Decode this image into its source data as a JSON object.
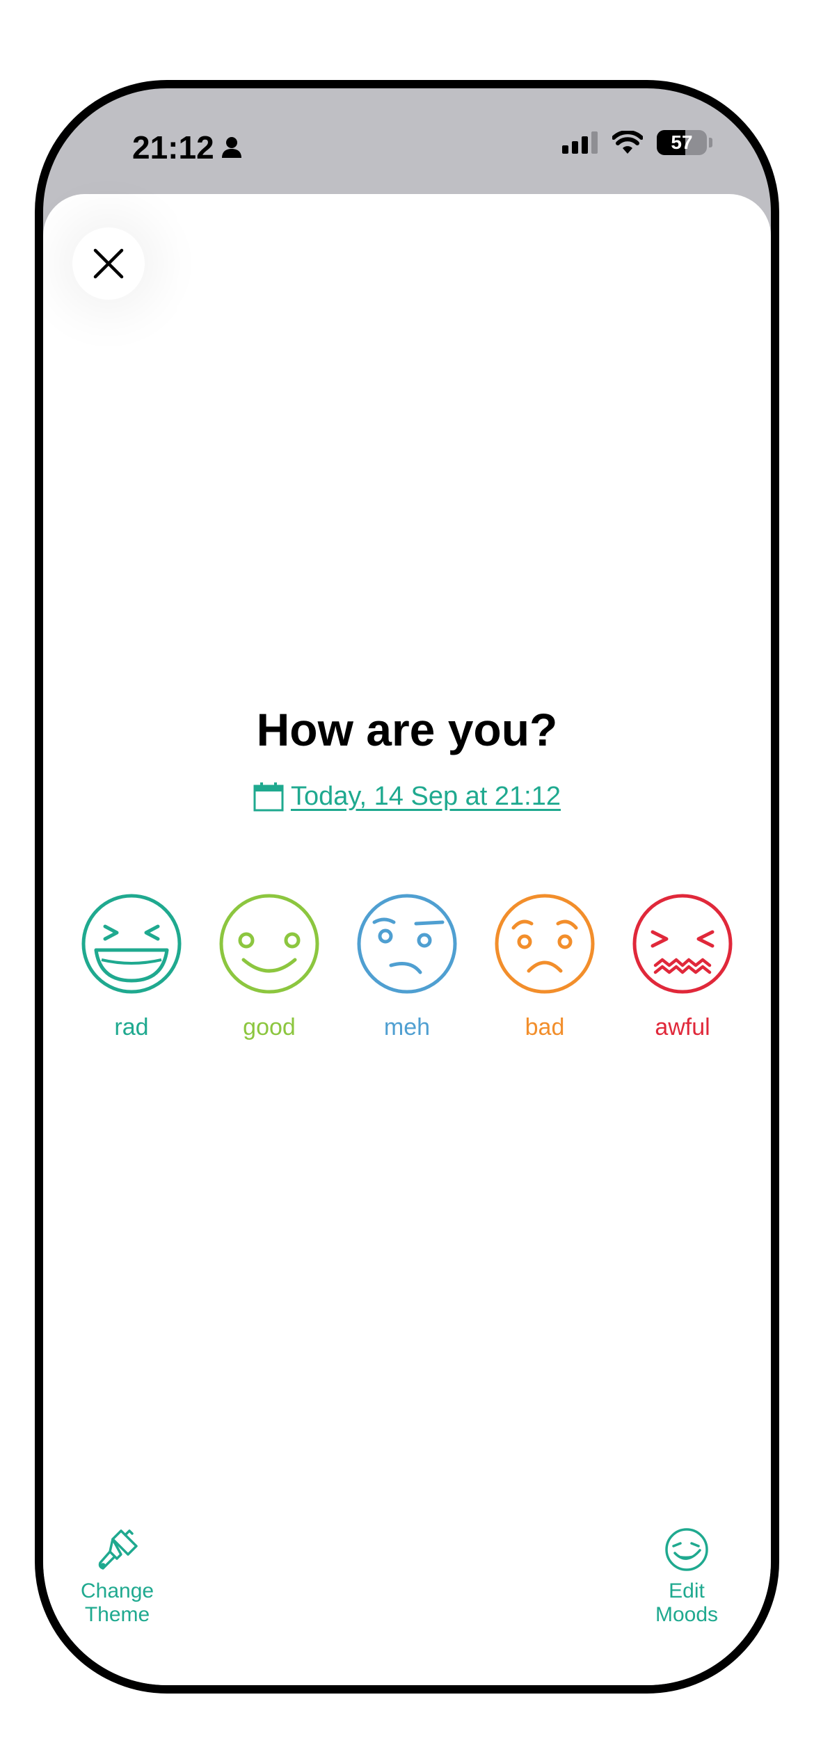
{
  "status_bar": {
    "time": "21:12",
    "battery_level": "57",
    "battery_fraction": 0.57,
    "icons": [
      "person-icon",
      "cellular-signal-icon",
      "wifi-icon",
      "battery-icon"
    ]
  },
  "header": {
    "close_icon": "close-icon"
  },
  "prompt": {
    "title": "How are you?",
    "date_label": "Today, 14 Sep at 21:12",
    "date_icon": "calendar-icon"
  },
  "moods": [
    {
      "label": "rad",
      "color": "#1fa98f",
      "icon": "rad-face-icon"
    },
    {
      "label": "good",
      "color": "#8cc63f",
      "icon": "good-face-icon"
    },
    {
      "label": "meh",
      "color": "#4f9fd1",
      "icon": "meh-face-icon"
    },
    {
      "label": "bad",
      "color": "#f28e2b",
      "icon": "bad-face-icon"
    },
    {
      "label": "awful",
      "color": "#e0283a",
      "icon": "awful-face-icon"
    }
  ],
  "footer": {
    "change_theme": {
      "label": "Change\nTheme",
      "icon": "paintbrush-icon"
    },
    "edit_moods": {
      "label": "Edit\nMoods",
      "icon": "mood-face-icon"
    }
  },
  "colors": {
    "accent": "#1fa98f",
    "status_bar_bg": "#bfbfc4"
  }
}
